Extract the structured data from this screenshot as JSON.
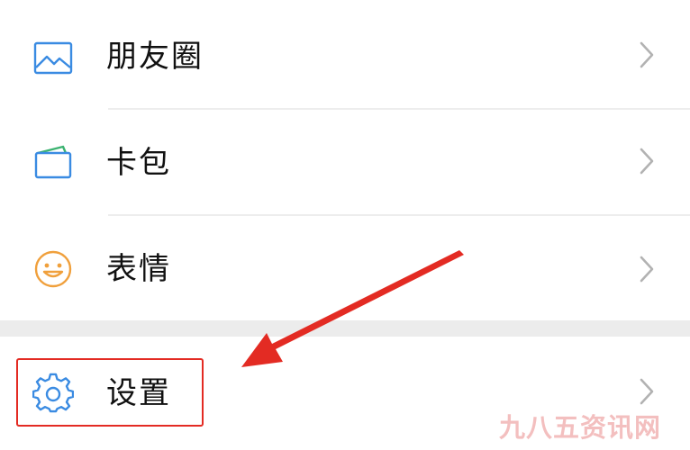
{
  "menu": {
    "items": [
      {
        "label": "朋友圈",
        "icon": "moments-image-icon",
        "has_chevron": true
      },
      {
        "label": "卡包",
        "icon": "card-wallet-icon",
        "has_chevron": true
      },
      {
        "label": "表情",
        "icon": "smiley-face-icon",
        "has_chevron": true
      },
      {
        "label": "设置",
        "icon": "gear-icon",
        "has_chevron": true,
        "highlighted": true
      }
    ]
  },
  "annotation": {
    "arrow_color": "#e32b23",
    "box_color": "#e32b23"
  },
  "watermark": {
    "text": "九八五资讯网"
  },
  "colors": {
    "icon_blue": "#3a8be2",
    "icon_green": "#3cb371",
    "icon_orange": "#f0a03c",
    "chevron": "#b2b2b2",
    "separator_bg": "#ececec"
  }
}
